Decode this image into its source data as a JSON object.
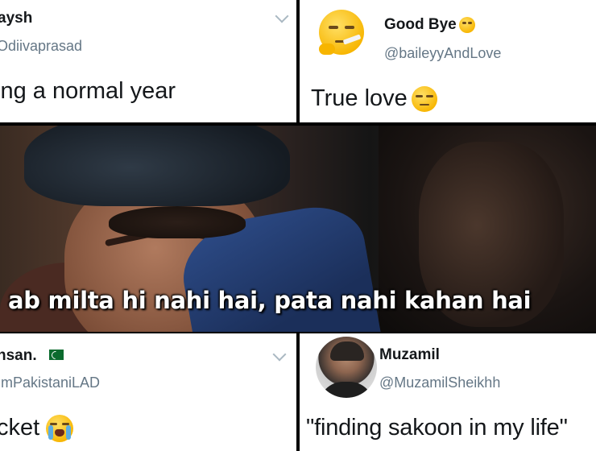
{
  "tweets": {
    "top_left": {
      "name": "aysh",
      "handle": "Odiivaprasad",
      "text": "ing a normal year",
      "chevron_icon": "chevron-down-icon"
    },
    "top_right": {
      "name": "Good Bye",
      "name_emoji_icon": "rolling-eyes-emoji-icon",
      "handle": "@baileyyAndLove",
      "text": "True love",
      "text_emoji_icon": "unamused-face-emoji-icon",
      "avatar_icon": "smoking-face-emoji-icon"
    },
    "bottom_left": {
      "name": "nsan.",
      "flag_icon": "pakistan-flag-icon",
      "handle": "imPakistaniLAD",
      "text": "cket",
      "text_emoji_icon": "loudly-crying-emoji-icon",
      "chevron_icon": "chevron-down-icon"
    },
    "bottom_right": {
      "name": "Muzamil",
      "handle": "@MuzamilSheikhh",
      "text": "\"finding sakoon in my life\"",
      "avatar_icon": "profile-photo-avatar"
    }
  },
  "meme": {
    "caption": "ab milta hi nahi hai, pata nahi kahan hai"
  },
  "colors": {
    "text": "#14171a",
    "handle": "#657786",
    "divider": "#000000",
    "caption": "#ffffff"
  }
}
